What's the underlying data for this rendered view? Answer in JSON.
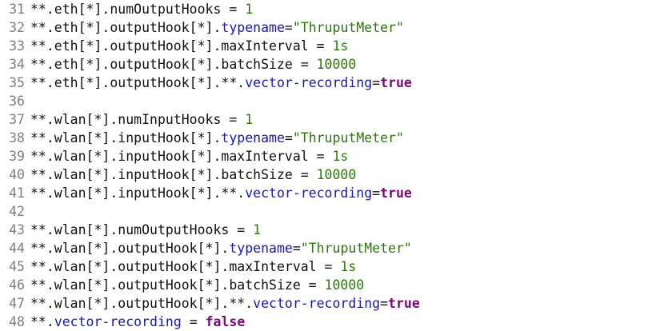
{
  "editor": {
    "colors": {
      "line_number": "#7f7f7f",
      "text": "#111111",
      "keyword_blue": "#1a1aa6",
      "value_green": "#2a7a0a",
      "boolean_purple": "#7a0a7a"
    },
    "lines": [
      {
        "num": "31",
        "tokens": [
          {
            "t": "**.eth[*].numOutputHooks = ",
            "c": "text"
          },
          {
            "t": "1",
            "c": "green"
          }
        ]
      },
      {
        "num": "32",
        "tokens": [
          {
            "t": "**.eth[*].outputHook[*].",
            "c": "text"
          },
          {
            "t": "typename",
            "c": "blue"
          },
          {
            "t": "=",
            "c": "text"
          },
          {
            "t": "\"ThruputMeter\"",
            "c": "green"
          }
        ]
      },
      {
        "num": "33",
        "tokens": [
          {
            "t": "**.eth[*].outputHook[*].maxInterval = ",
            "c": "text"
          },
          {
            "t": "1s",
            "c": "green"
          }
        ]
      },
      {
        "num": "34",
        "tokens": [
          {
            "t": "**.eth[*].outputHook[*].batchSize = ",
            "c": "text"
          },
          {
            "t": "10000",
            "c": "green"
          }
        ]
      },
      {
        "num": "35",
        "tokens": [
          {
            "t": "**.eth[*].outputHook[*].**.",
            "c": "text"
          },
          {
            "t": "vector-recording",
            "c": "blue"
          },
          {
            "t": "=",
            "c": "text"
          },
          {
            "t": "true",
            "c": "purple"
          }
        ]
      },
      {
        "num": "36",
        "tokens": []
      },
      {
        "num": "37",
        "tokens": [
          {
            "t": "**.wlan[*].numInputHooks = ",
            "c": "text"
          },
          {
            "t": "1",
            "c": "green"
          }
        ]
      },
      {
        "num": "38",
        "tokens": [
          {
            "t": "**.wlan[*].inputHook[*].",
            "c": "text"
          },
          {
            "t": "typename",
            "c": "blue"
          },
          {
            "t": "=",
            "c": "text"
          },
          {
            "t": "\"ThruputMeter\"",
            "c": "green"
          }
        ]
      },
      {
        "num": "39",
        "tokens": [
          {
            "t": "**.wlan[*].inputHook[*].maxInterval = ",
            "c": "text"
          },
          {
            "t": "1s",
            "c": "green"
          }
        ]
      },
      {
        "num": "40",
        "tokens": [
          {
            "t": "**.wlan[*].inputHook[*].batchSize = ",
            "c": "text"
          },
          {
            "t": "10000",
            "c": "green"
          }
        ]
      },
      {
        "num": "41",
        "tokens": [
          {
            "t": "**.wlan[*].inputHook[*].**.",
            "c": "text"
          },
          {
            "t": "vector-recording",
            "c": "blue"
          },
          {
            "t": "=",
            "c": "text"
          },
          {
            "t": "true",
            "c": "purple"
          }
        ]
      },
      {
        "num": "42",
        "tokens": []
      },
      {
        "num": "43",
        "tokens": [
          {
            "t": "**.wlan[*].numOutputHooks = ",
            "c": "text"
          },
          {
            "t": "1",
            "c": "green"
          }
        ]
      },
      {
        "num": "44",
        "tokens": [
          {
            "t": "**.wlan[*].outputHook[*].",
            "c": "text"
          },
          {
            "t": "typename",
            "c": "blue"
          },
          {
            "t": "=",
            "c": "text"
          },
          {
            "t": "\"ThruputMeter\"",
            "c": "green"
          }
        ]
      },
      {
        "num": "45",
        "tokens": [
          {
            "t": "**.wlan[*].outputHook[*].maxInterval = ",
            "c": "text"
          },
          {
            "t": "1s",
            "c": "green"
          }
        ]
      },
      {
        "num": "46",
        "tokens": [
          {
            "t": "**.wlan[*].outputHook[*].batchSize = ",
            "c": "text"
          },
          {
            "t": "10000",
            "c": "green"
          }
        ]
      },
      {
        "num": "47",
        "tokens": [
          {
            "t": "**.wlan[*].outputHook[*].**.",
            "c": "text"
          },
          {
            "t": "vector-recording",
            "c": "blue"
          },
          {
            "t": "=",
            "c": "text"
          },
          {
            "t": "true",
            "c": "purple"
          }
        ]
      },
      {
        "num": "48",
        "tokens": [
          {
            "t": "**.",
            "c": "text"
          },
          {
            "t": "vector-recording",
            "c": "blue"
          },
          {
            "t": " = ",
            "c": "text"
          },
          {
            "t": "false",
            "c": "purple"
          }
        ]
      }
    ]
  }
}
